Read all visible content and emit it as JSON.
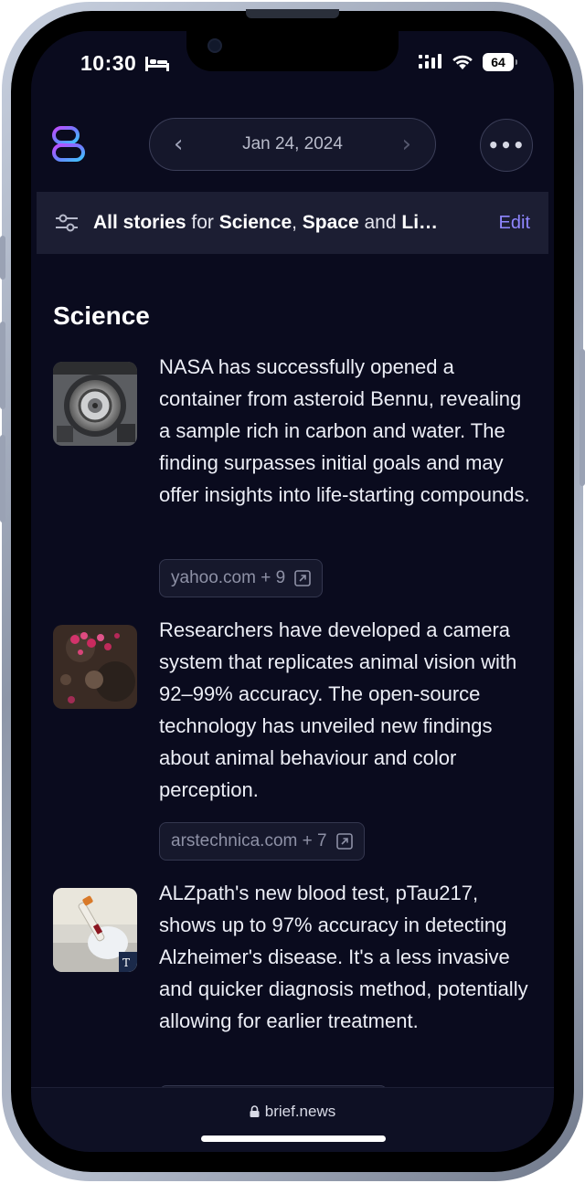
{
  "status_bar": {
    "time": "10:30",
    "battery": "64"
  },
  "header": {
    "date": "Jan 24, 2024",
    "prev_glyph": "‹",
    "next_glyph": "›",
    "more_glyph": "•••"
  },
  "filter": {
    "all_stories": "All stories",
    "for": " for ",
    "science": "Science",
    "comma": ", ",
    "space": "Space",
    "and": " and ",
    "li": "Li…",
    "edit": "Edit"
  },
  "section": {
    "title": "Science"
  },
  "stories": [
    {
      "text": "NASA has successfully opened a container from asteroid Bennu, revealing a sample rich in carbon and water. The finding surpasses initial goals and may offer insights into life-starting compounds.",
      "source": "yahoo.com + 9",
      "thumb_icon": "asteroid-sample-container-image"
    },
    {
      "text": "Researchers have developed a camera system that replicates animal vision with 92–99% accuracy. The open-source technology has unveiled new findings about animal behaviour and color perception.",
      "source": "arstechnica.com + 7",
      "thumb_icon": "flowers-image"
    },
    {
      "text": "ALZpath's new blood test, pTau217, shows up to 97% accuracy in detecting Alzheimer's disease. It's a less invasive and quicker diagnosis method, potentially allowing for earlier treatment.",
      "source": "",
      "thumb_icon": "blood-test-tube-image"
    }
  ],
  "bottom": {
    "url": "brief.news"
  },
  "colors": {
    "background": "#0a0b1e",
    "accent": "#8f86ff",
    "filter_bar": "#1c1e33"
  }
}
